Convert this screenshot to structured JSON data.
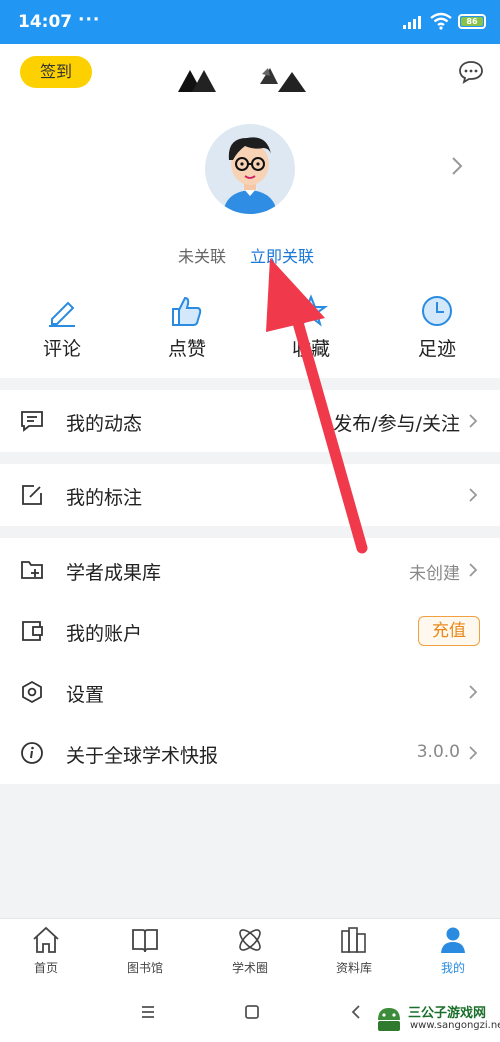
{
  "status_bar": {
    "time": "14:07",
    "dots": "···",
    "battery": "86"
  },
  "header": {
    "signin_label": "签到"
  },
  "profile": {
    "link_status": "未关联",
    "link_now": "立即关联"
  },
  "actions": [
    {
      "label": "评论",
      "icon": "pencil-icon"
    },
    {
      "label": "点赞",
      "icon": "thumbs-up-icon"
    },
    {
      "label": "收藏",
      "icon": "star-icon"
    },
    {
      "label": "足迹",
      "icon": "clock-icon"
    }
  ],
  "menu": {
    "dynamics": {
      "label": "我的动态",
      "right": "发布/参与/关注"
    },
    "annotations": {
      "label": "我的标注"
    },
    "scholar": {
      "label": "学者成果库",
      "right": "未创建"
    },
    "account": {
      "label": "我的账户",
      "button": "充值"
    },
    "settings": {
      "label": "设置"
    },
    "about": {
      "label": "关于全球学术快报",
      "right": "3.0.0"
    }
  },
  "tabs": [
    {
      "label": "首页",
      "icon": "home-icon"
    },
    {
      "label": "图书馆",
      "icon": "book-icon"
    },
    {
      "label": "学术圈",
      "icon": "atom-icon"
    },
    {
      "label": "资料库",
      "icon": "library-icon"
    },
    {
      "label": "我的",
      "icon": "person-icon",
      "active": true
    }
  ],
  "watermark": {
    "name": "三公子游戏网",
    "url": "www.sangongzi.net"
  },
  "colors": {
    "primary": "#2196f3",
    "accent_link": "#1a78d8",
    "signin": "#fdd100",
    "arrow": "#f0394b",
    "recharge": "#e8891c"
  }
}
